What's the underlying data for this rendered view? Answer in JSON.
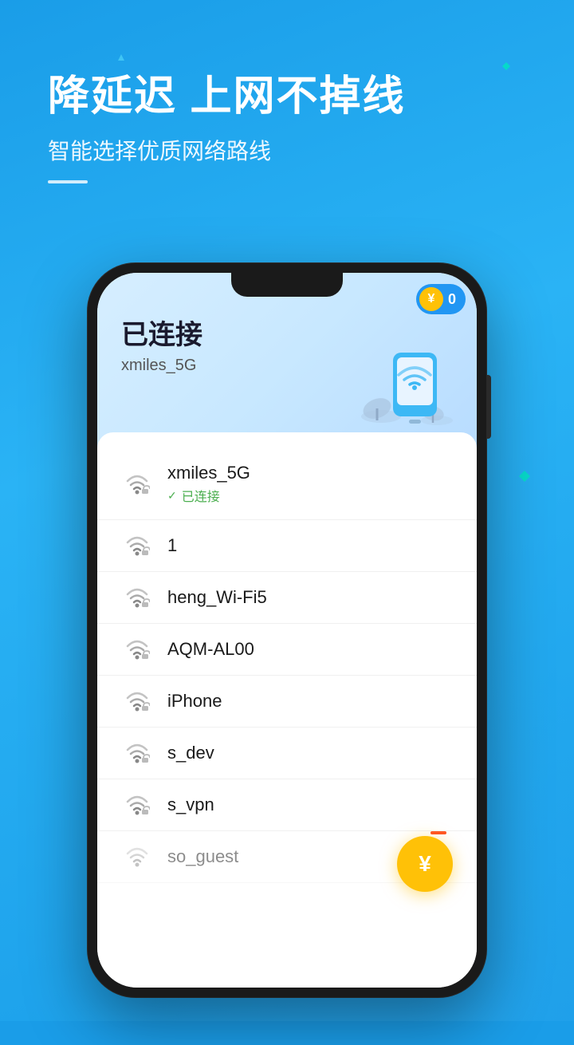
{
  "header": {
    "title_line1": "降延迟  上网不掉线",
    "subtitle": "智能选择优质网络路线"
  },
  "coin": {
    "icon": "¥",
    "count": "0"
  },
  "screen_header": {
    "connected_label": "已连接",
    "network_name": "xmiles_5G"
  },
  "networks": [
    {
      "ssid": "xmiles_5G",
      "connected": true,
      "connected_text": "已连接",
      "locked": false
    },
    {
      "ssid": "1",
      "connected": false,
      "locked": true
    },
    {
      "ssid": "heng_Wi-Fi5",
      "connected": false,
      "locked": true
    },
    {
      "ssid": "AQM-AL00",
      "connected": false,
      "locked": true
    },
    {
      "ssid": "iPhone",
      "connected": false,
      "locked": true
    },
    {
      "ssid": "s_dev",
      "connected": false,
      "locked": true
    },
    {
      "ssid": "s_vpn",
      "connected": false,
      "locked": true
    },
    {
      "ssid": "so_guest",
      "connected": false,
      "locked": true
    }
  ],
  "float_button": {
    "icon": "¥"
  }
}
